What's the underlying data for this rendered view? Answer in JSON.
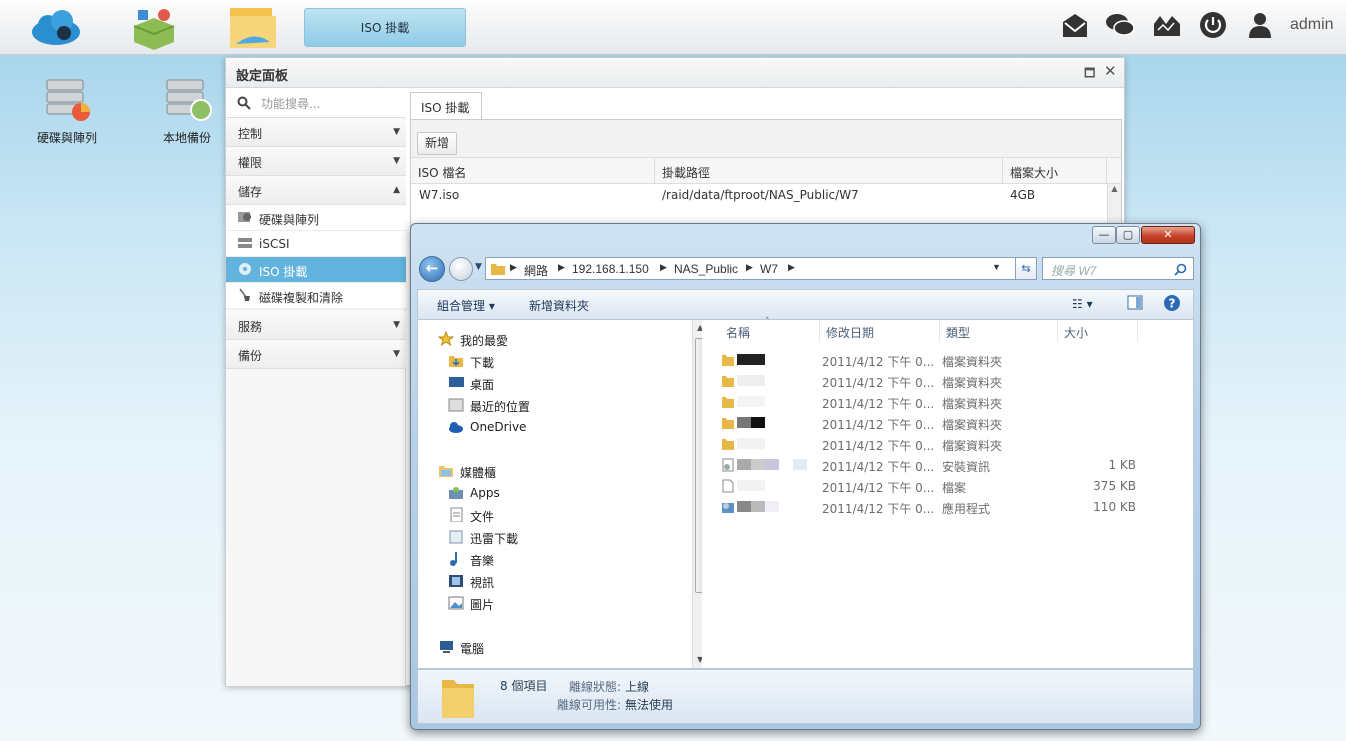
{
  "topbar": {
    "active_app": "ISO 掛載",
    "user": "admin"
  },
  "desktop": {
    "icons": [
      {
        "label": "硬碟與陣列"
      },
      {
        "label": "本地備份"
      }
    ]
  },
  "settings": {
    "title": "設定面板",
    "search_placeholder": "功能搜尋...",
    "nav": {
      "control": "控制",
      "permission": "權限",
      "storage": "儲存",
      "storage_items": [
        "硬碟與陣列",
        "iSCSI",
        "ISO 掛載",
        "磁碟複製和清除"
      ],
      "service": "服務",
      "backup": "備份"
    },
    "tab": "ISO 掛載",
    "add_label": "新增",
    "columns": [
      "ISO 檔名",
      "掛載路徑",
      "檔案大小"
    ],
    "rows": [
      {
        "name": "W7.iso",
        "path": "/raid/data/ftproot/NAS_Public/W7",
        "size": "4GB"
      }
    ]
  },
  "explorer": {
    "breadcrumb": [
      "網路",
      "192.168.1.150",
      "NAS_Public",
      "W7"
    ],
    "search_placeholder": "搜尋 W7",
    "commands": {
      "organize": "組合管理",
      "new_folder": "新增資料夾"
    },
    "tree": {
      "favorites": "我的最愛",
      "fav_items": [
        "下載",
        "桌面",
        "最近的位置",
        "OneDrive"
      ],
      "libraries": "媒體櫃",
      "lib_items": [
        "Apps",
        "文件",
        "迅雷下載",
        "音樂",
        "視訊",
        "圖片"
      ],
      "computer": "電腦"
    },
    "columns": [
      "名稱",
      "修改日期",
      "類型",
      "大小"
    ],
    "files": [
      {
        "date": "2011/4/12 下午 0...",
        "type": "檔案資料夾",
        "size": ""
      },
      {
        "date": "2011/4/12 下午 0...",
        "type": "檔案資料夾",
        "size": ""
      },
      {
        "date": "2011/4/12 下午 0...",
        "type": "檔案資料夾",
        "size": ""
      },
      {
        "date": "2011/4/12 下午 0...",
        "type": "檔案資料夾",
        "size": ""
      },
      {
        "date": "2011/4/12 下午 0...",
        "type": "檔案資料夾",
        "size": ""
      },
      {
        "date": "2011/4/12 下午 0...",
        "type": "安裝資訊",
        "size": "1 KB"
      },
      {
        "date": "2011/4/12 下午 0...",
        "type": "檔案",
        "size": "375 KB"
      },
      {
        "date": "2011/4/12 下午 0...",
        "type": "應用程式",
        "size": "110 KB"
      }
    ],
    "status": {
      "count": "8 個項目",
      "offline_label": "離線狀態:",
      "offline_value": "上線",
      "avail_label": "離線可用性:",
      "avail_value": "無法使用"
    }
  },
  "colors": {
    "accent": "#62b3dd",
    "close_red": "#c6432b"
  }
}
